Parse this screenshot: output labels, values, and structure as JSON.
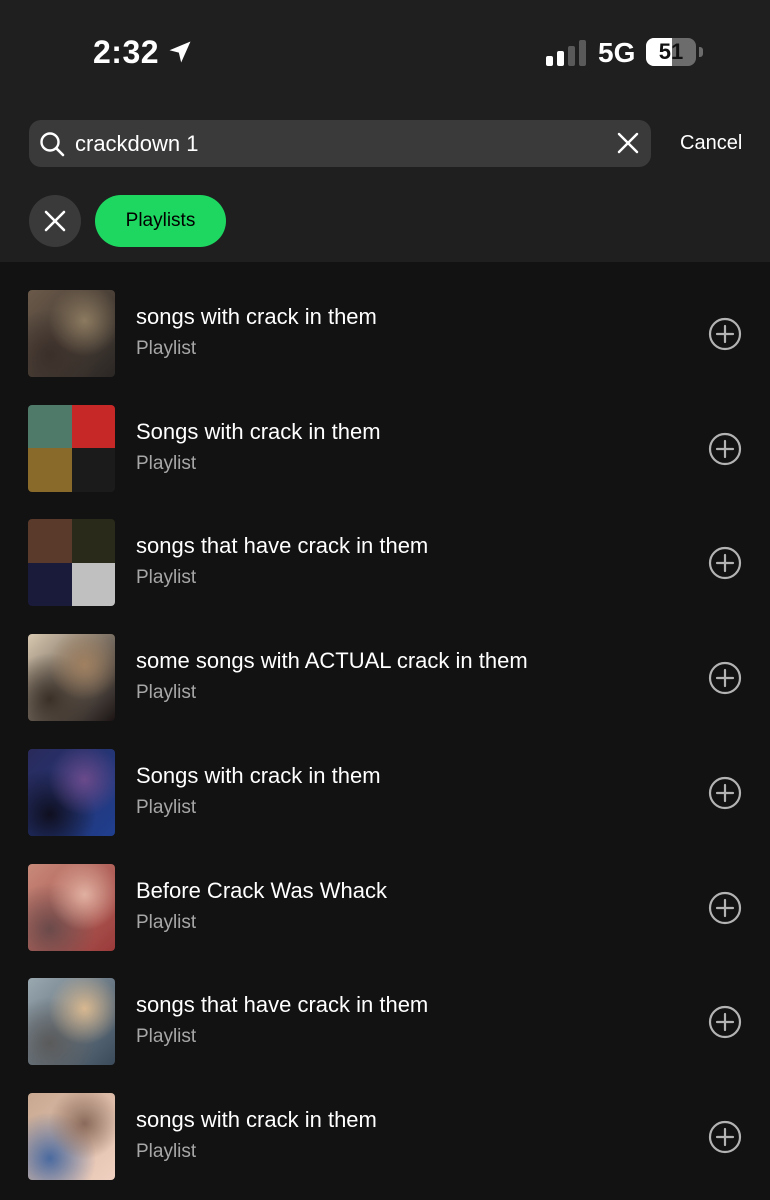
{
  "status_bar": {
    "time": "2:32",
    "network": "5G",
    "battery": "51",
    "battery_level": 0.51
  },
  "search": {
    "query": "crackdown 1",
    "cancel_label": "Cancel"
  },
  "filters": {
    "active_chip": "Playlists"
  },
  "results": [
    {
      "title": "songs with crack in them",
      "subtitle": "Playlist",
      "art_colors": [
        "#6b5a4a",
        "#2a2624",
        "#8c7a60",
        "#3b2f2a"
      ],
      "art": "single"
    },
    {
      "title": "Songs with crack in them",
      "subtitle": "Playlist",
      "art_colors": [
        "#4f7a6a",
        "#c62828",
        "#8a6a2a",
        "#1b1b1b"
      ],
      "art": "grid"
    },
    {
      "title": "songs that have crack in them",
      "subtitle": "Playlist",
      "art_colors": [
        "#5a3a2a",
        "#2a2a1a",
        "#1a1a3a",
        "#c0c0c0"
      ],
      "art": "grid"
    },
    {
      "title": "some songs with ACTUAL crack in them",
      "subtitle": "Playlist",
      "art_colors": [
        "#d8c8b0",
        "#1a1414",
        "#a08060",
        "#3a3028"
      ],
      "art": "single"
    },
    {
      "title": "Songs with crack in them",
      "subtitle": "Playlist",
      "art_colors": [
        "#2a2a5a",
        "#1f3f8f",
        "#6a4a8a",
        "#0f0f1f"
      ],
      "art": "single"
    },
    {
      "title": "Before Crack Was Whack",
      "subtitle": "Playlist",
      "art_colors": [
        "#c88a7a",
        "#9a3a3a",
        "#e0b0a0",
        "#6a4a4a"
      ],
      "art": "single"
    },
    {
      "title": "songs that have crack in them",
      "subtitle": "Playlist",
      "art_colors": [
        "#9aa8b0",
        "#3a4a5a",
        "#d8b890",
        "#5a5a5a"
      ],
      "art": "single"
    },
    {
      "title": "songs with crack in them",
      "subtitle": "Playlist",
      "art_colors": [
        "#c8a890",
        "#f0d0c0",
        "#8a6a5a",
        "#4a6aa0"
      ],
      "art": "single"
    }
  ]
}
